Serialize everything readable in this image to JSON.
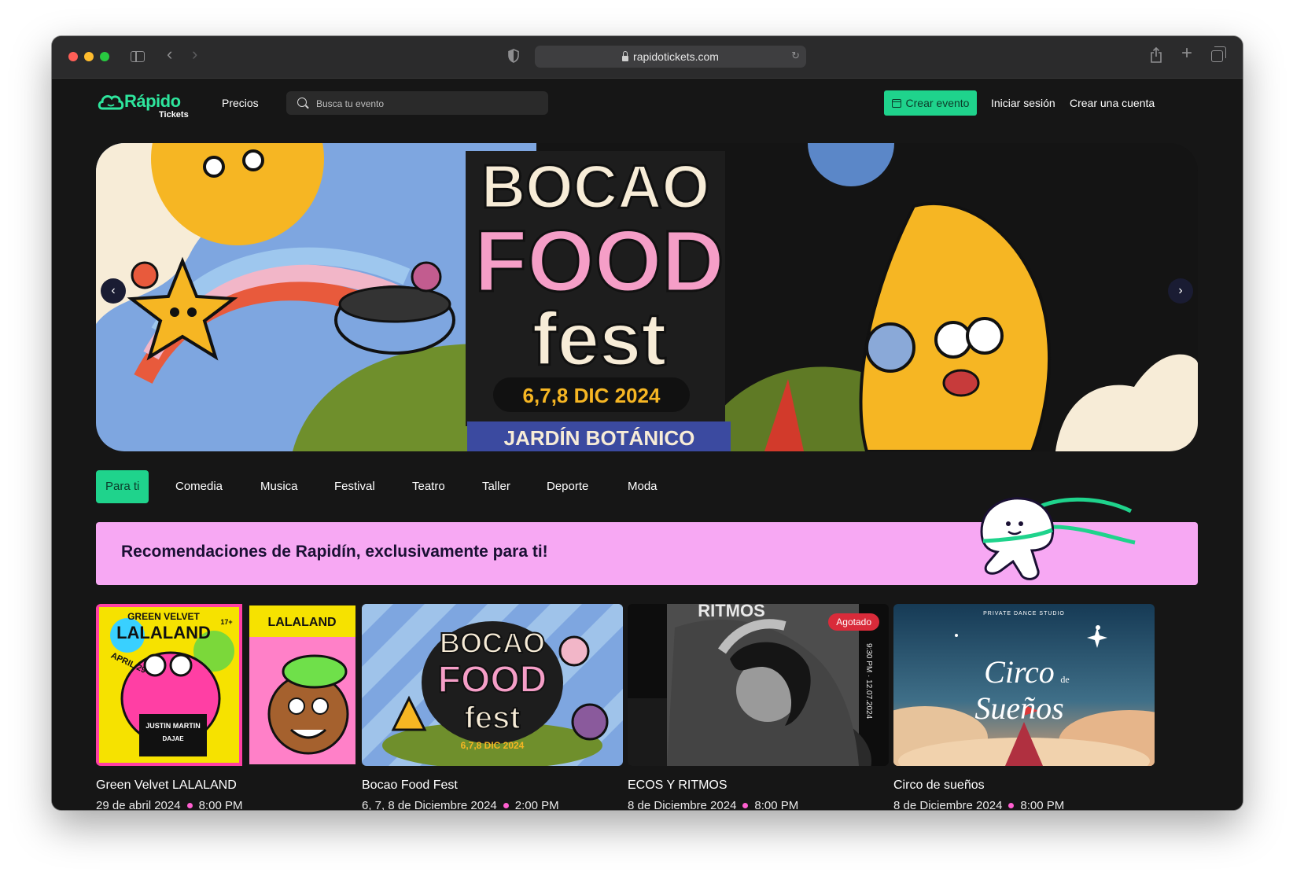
{
  "browser": {
    "url": "rapidotickets.com"
  },
  "header": {
    "logo_word": "Rápido",
    "logo_sub": "Tickets",
    "pricing_label": "Precios",
    "search_placeholder": "Busca tu evento",
    "create_event_label": "Crear evento",
    "login_label": "Iniciar sesión",
    "signup_label": "Crear una cuenta"
  },
  "hero": {
    "title_line1": "BOCAO",
    "title_line2": "FOOD",
    "title_line3": "fest",
    "dates": "6,7,8 DIC 2024",
    "venue": "JARDÍN BOTÁNICO"
  },
  "categories": [
    "Para ti",
    "Comedia",
    "Musica",
    "Festival",
    "Teatro",
    "Taller",
    "Deporte",
    "Moda"
  ],
  "banner": {
    "text": "Recomendaciones de Rapidín, exclusivamente para ti!"
  },
  "events": [
    {
      "title": "Green Velvet LALALAND",
      "date": "29 de abril 2024",
      "time": "8:00 PM",
      "poster": {
        "line1": "GREEN VELVET",
        "line2": "LALALAND",
        "line3": "APRIL 29",
        "line4": "JUSTIN MARTIN",
        "line5": "DAJAE",
        "line6": "17+"
      }
    },
    {
      "title": "Bocao Food Fest",
      "date": "6, 7, 8 de Diciembre 2024",
      "time": "2:00 PM",
      "poster": {
        "line1": "BOCAO",
        "line2": "FOOD",
        "line3": "fest",
        "line4": "6,7,8 DIC 2024"
      }
    },
    {
      "title": "ECOS Y RITMOS",
      "date": "8 de Diciembre 2024",
      "time": "8:00 PM",
      "badge": "Agotado",
      "poster": {
        "line1": "RITMOS",
        "line2": "9:30 PM · 12.07.2024"
      }
    },
    {
      "title": "Circo de sueños",
      "date": "8 de Diciembre 2024",
      "time": "8:00 PM",
      "poster": {
        "line1": "PRIVATE DANCE STUDIO",
        "line2": "Circo",
        "line3": "de",
        "line4": "Sueños"
      }
    }
  ],
  "colors": {
    "accent": "#1fd38c",
    "background": "#161616",
    "banner": "#f7a8f3",
    "sold_out": "#d92b3a"
  }
}
